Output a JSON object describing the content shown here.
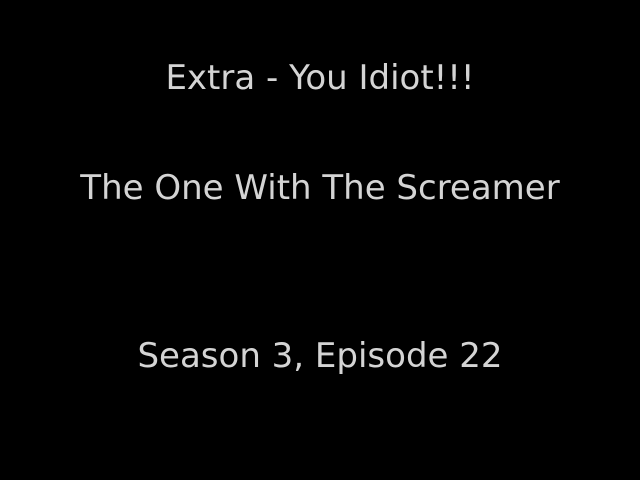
{
  "card": {
    "line1": "Extra - You Idiot!!!",
    "line2": "The One With The Screamer",
    "line3": "Season 3, Episode 22"
  },
  "colors": {
    "background": "#000000",
    "text": "#d4d4d4"
  }
}
